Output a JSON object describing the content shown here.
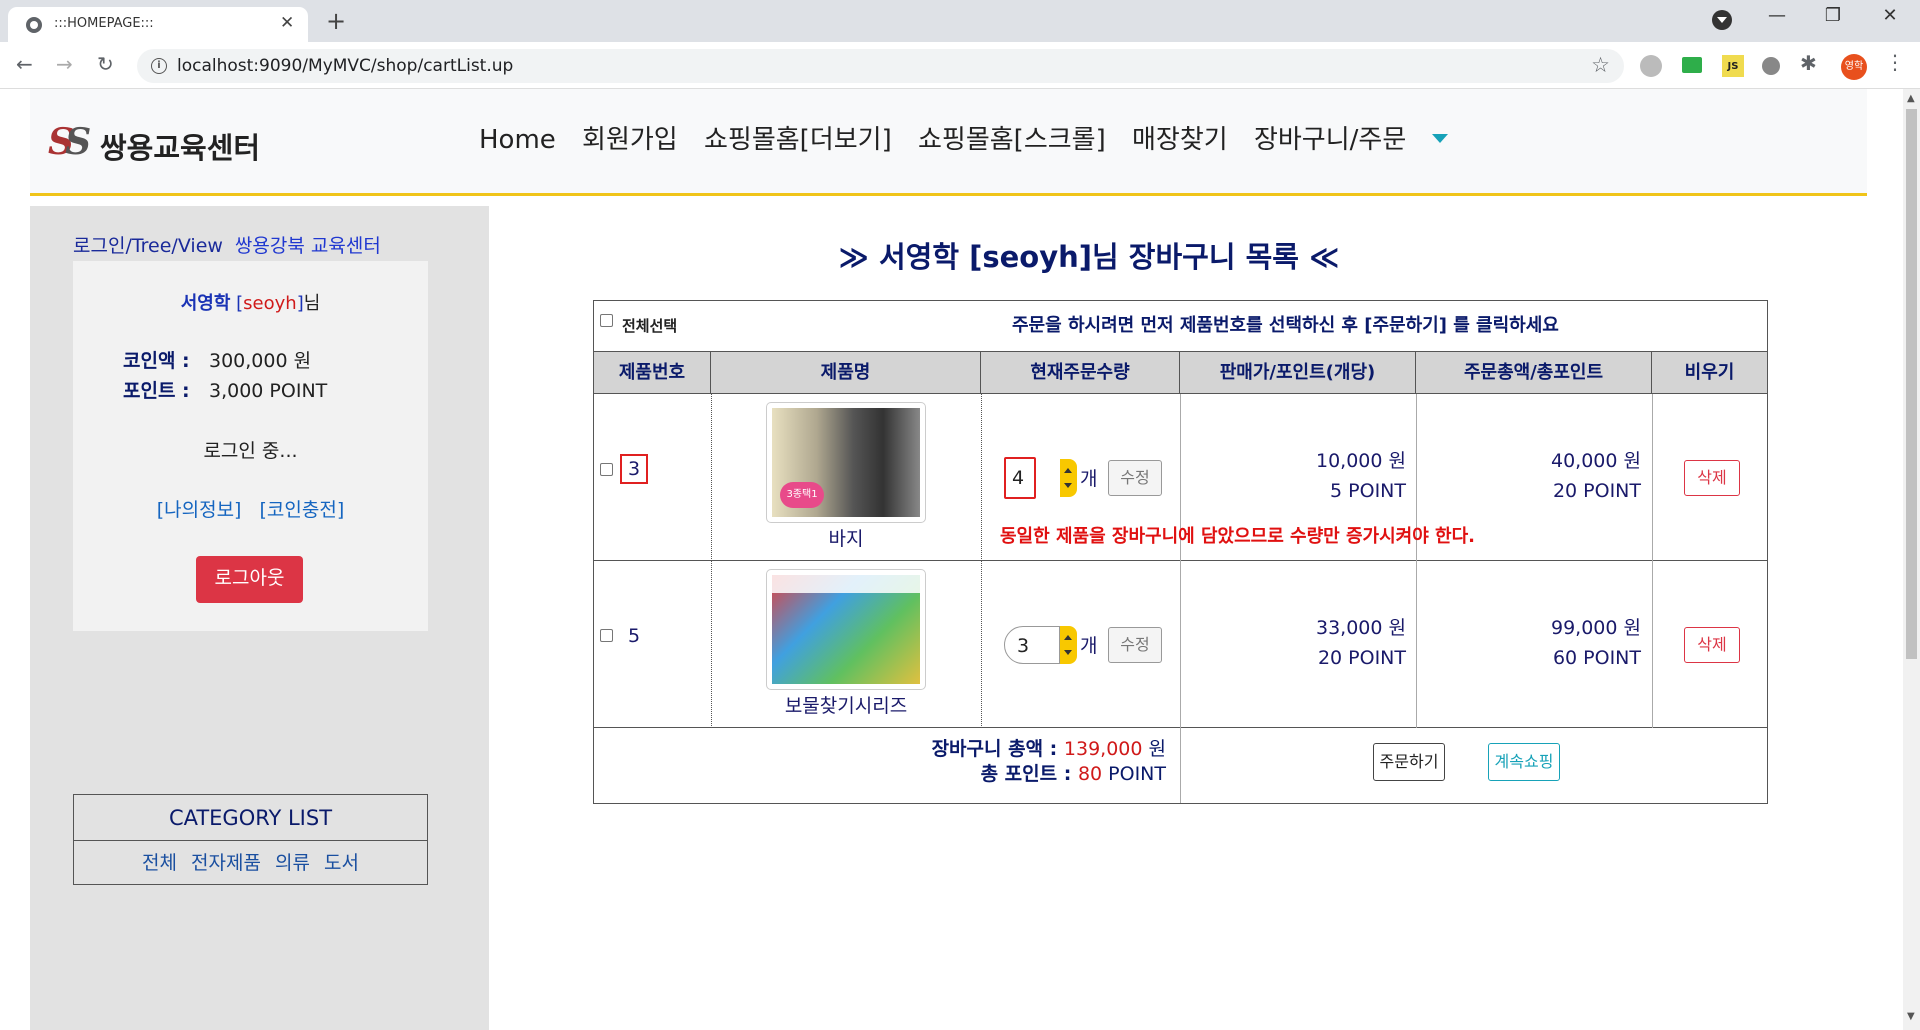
{
  "browser": {
    "tab_title": ":::HOMEPAGE:::",
    "url": "localhost:9090/MyMVC/shop/cartList.up",
    "profile_label": "영학"
  },
  "header": {
    "logo_text": "쌍용교육센터",
    "nav": [
      "Home",
      "회원가입",
      "쇼핑몰홈[더보기]",
      "쇼핑몰홈[스크롤]",
      "매장찾기"
    ],
    "nav_active": "장바구니/주문"
  },
  "sidebar": {
    "head_link1": "로그인/Tree/View",
    "head_link2": "쌍용강북 교육센터",
    "user_name": "서영학",
    "user_id": "seoyh",
    "user_suffix": "님",
    "coin_label": "코인액 :",
    "coin_value": "300,000 원",
    "point_label": "포인트 :",
    "point_value": "3,000 POINT",
    "login_state": "로그인 중...",
    "my_info": "[나의정보]",
    "coin_charge": "[코인충전]",
    "logout": "로그아웃",
    "category_title": "CATEGORY LIST",
    "categories": [
      "전체",
      "전자제품",
      "의류",
      "도서"
    ]
  },
  "cart": {
    "title": "≫  서영학 [seoyh]님 장바구니 목록  ≪",
    "select_all": "전체선택",
    "instruction": "주문을 하시려면 먼저 제품번호를 선택하신 후 [주문하기] 를 클릭하세요",
    "headers": [
      "제품번호",
      "제품명",
      "현재주문수량",
      "판매가/포인트(개당)",
      "주문총액/총포인트",
      "비우기"
    ],
    "items": [
      {
        "no": "3",
        "name": "바지",
        "qty": "4",
        "unit": "개",
        "edit": "수정",
        "price": "10,000 원",
        "point": "5 POINT",
        "total_price": "40,000 원",
        "total_point": "20 POINT",
        "delete": "삭제",
        "warning": "동일한 제품을 장바구니에 담았으므로 수량만 증가시켜야 한다."
      },
      {
        "no": "5",
        "name": "보물찾기시리즈",
        "qty": "3",
        "unit": "개",
        "edit": "수정",
        "price": "33,000 원",
        "point": "20 POINT",
        "total_price": "99,000 원",
        "total_point": "60 POINT",
        "delete": "삭제"
      }
    ],
    "total_label": "장바구니 총액 : ",
    "total_value": "139,000",
    "total_unit": " 원",
    "total_point_label": "총 포인트 : ",
    "total_point_value": "80",
    "total_point_unit": " POINT",
    "order_button": "주문하기",
    "continue_button": "계속쇼핑"
  },
  "colors": {
    "accent_yellow": "#f0c419",
    "nav_active": "#17a2b8",
    "logout": "#dc3545",
    "highlight_red": "#e02020"
  }
}
